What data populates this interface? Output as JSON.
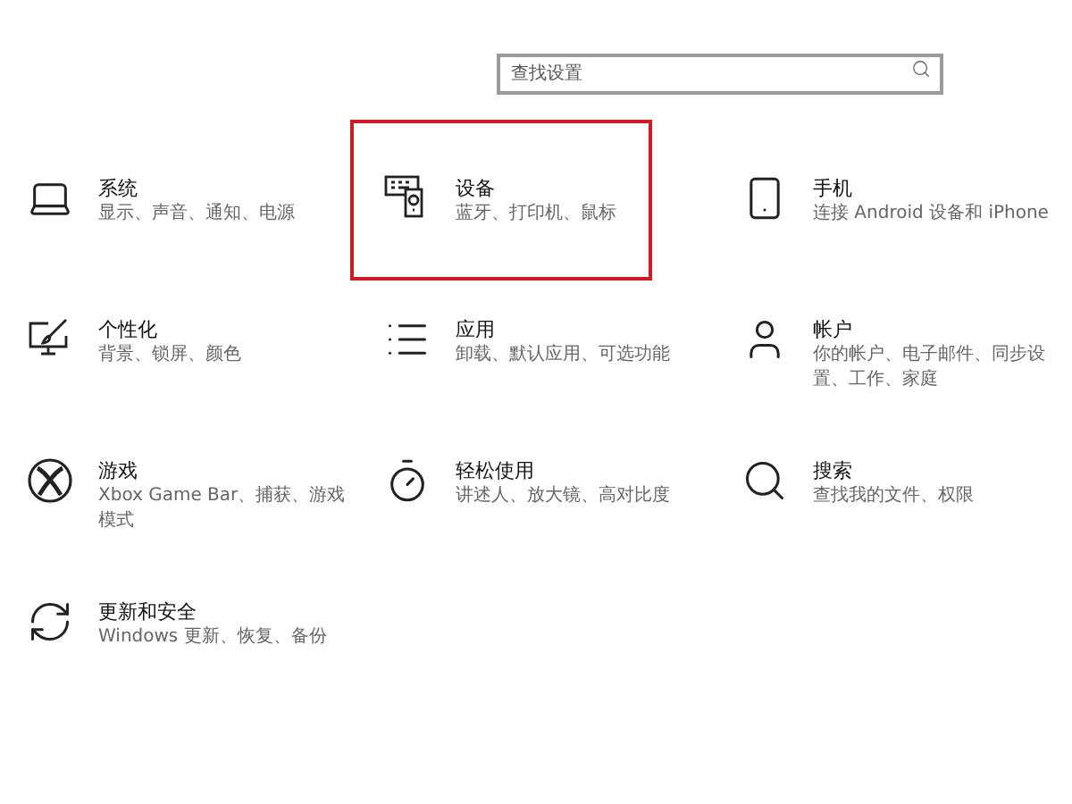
{
  "search": {
    "placeholder": "查找设置"
  },
  "items": [
    {
      "title": "系统",
      "subtitle": "显示、声音、通知、电源",
      "highlighted": false
    },
    {
      "title": "设备",
      "subtitle": "蓝牙、打印机、鼠标",
      "highlighted": true
    },
    {
      "title": "手机",
      "subtitle": "连接 Android 设备和 iPhone",
      "highlighted": false
    },
    {
      "title": "个性化",
      "subtitle": "背景、锁屏、颜色",
      "highlighted": false
    },
    {
      "title": "应用",
      "subtitle": "卸载、默认应用、可选功能",
      "highlighted": false
    },
    {
      "title": "帐户",
      "subtitle": "你的帐户、电子邮件、同步设置、工作、家庭",
      "highlighted": false
    },
    {
      "title": "游戏",
      "subtitle": "Xbox Game Bar、捕获、游戏模式",
      "highlighted": false
    },
    {
      "title": "轻松使用",
      "subtitle": "讲述人、放大镜、高对比度",
      "highlighted": false
    },
    {
      "title": "搜索",
      "subtitle": "查找我的文件、权限",
      "highlighted": false
    },
    {
      "title": "更新和安全",
      "subtitle": "Windows 更新、恢复、备份",
      "highlighted": false
    }
  ]
}
